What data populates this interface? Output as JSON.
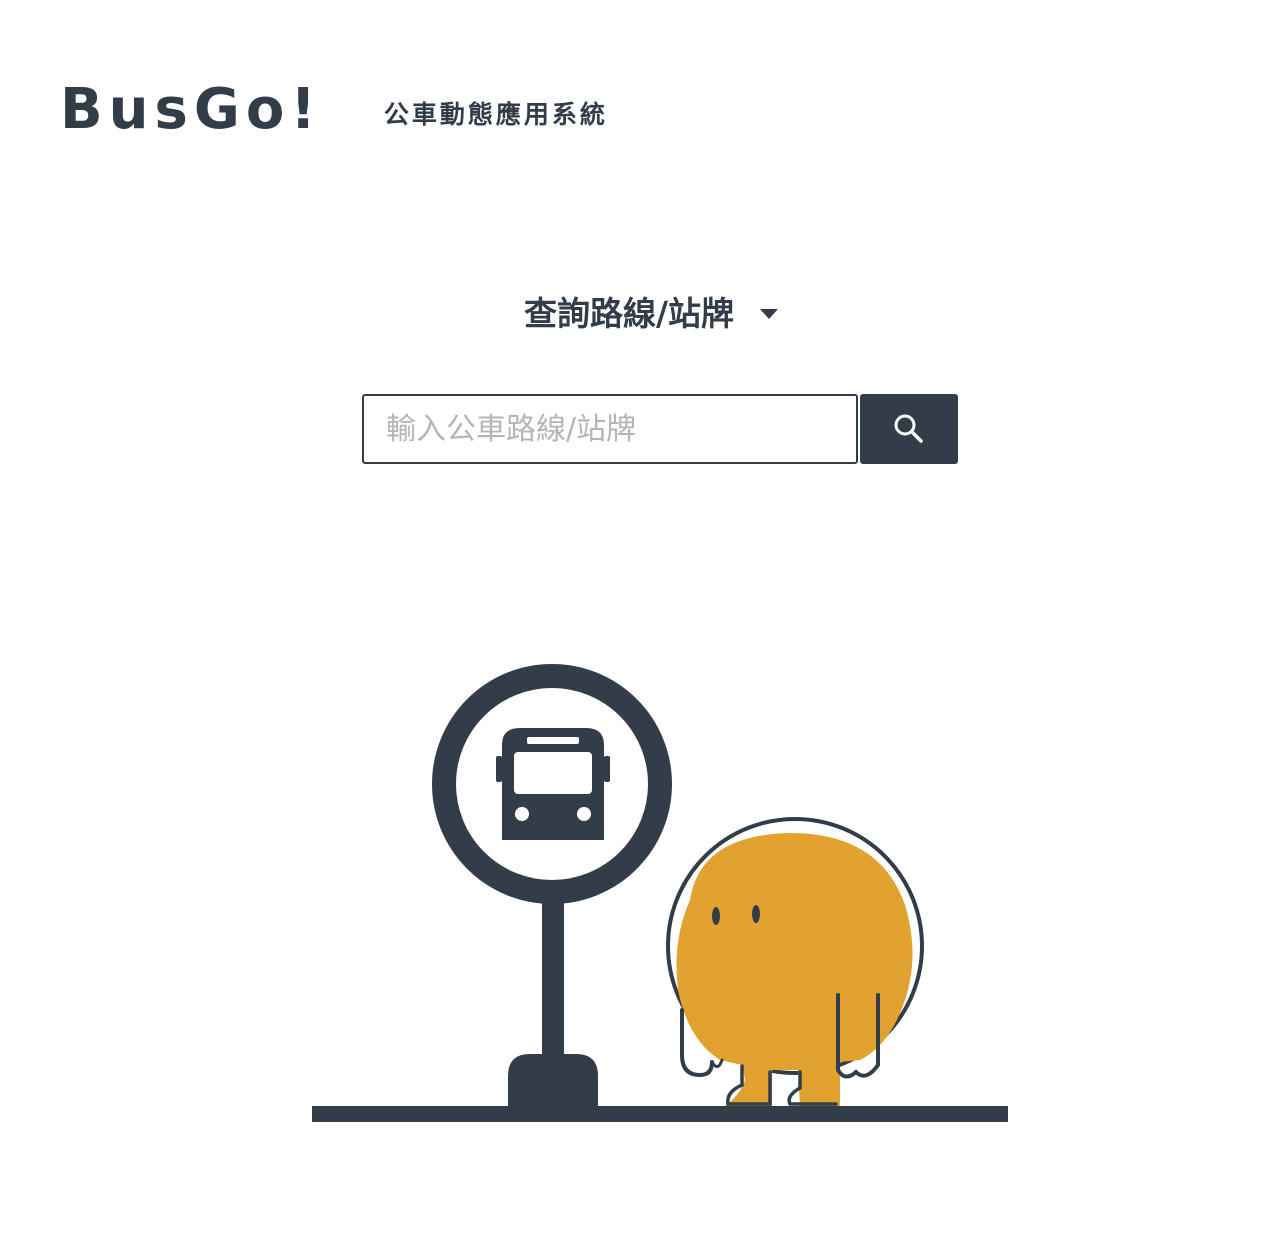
{
  "header": {
    "logo": "BusGo!",
    "tagline": "公車動態應用系統"
  },
  "search": {
    "mode_label": "查詢路線/站牌",
    "placeholder": "輸入公車路線/站牌",
    "value": ""
  },
  "icons": {
    "dropdown": "caret-down-icon",
    "search": "search-icon",
    "bus_stop": "bus-stop-sign-icon",
    "bus": "bus-icon",
    "mascot": "mascot-character"
  },
  "colors": {
    "primary": "#333d4a",
    "mascot": "#e2a22f",
    "placeholder": "#b5b5b5",
    "background": "#ffffff"
  }
}
